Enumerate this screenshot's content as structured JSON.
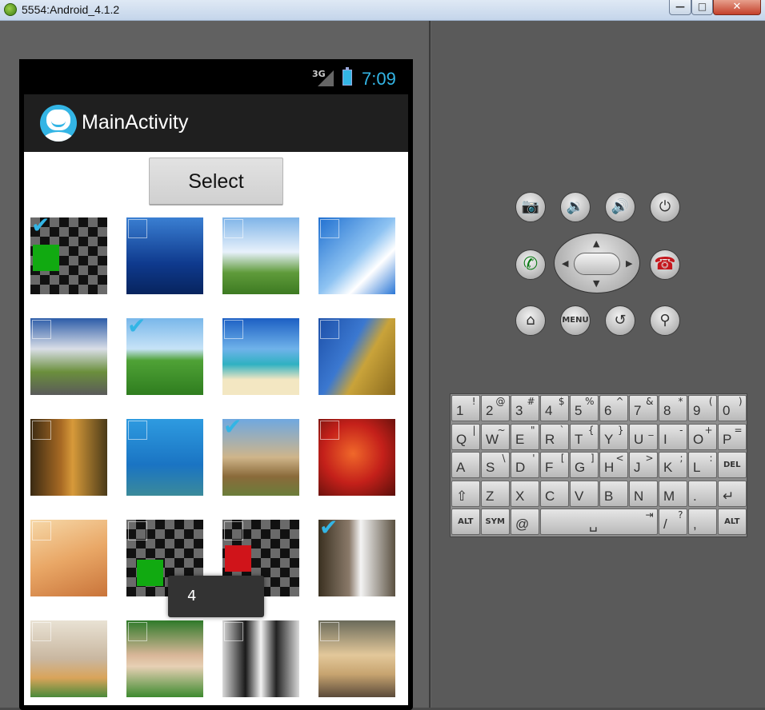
{
  "window": {
    "title": "5554:Android_4.1.2",
    "min_glyph": "—",
    "max_glyph": "□",
    "close_glyph": "✕"
  },
  "status_bar": {
    "network": "3G",
    "time": "7:09"
  },
  "action_bar": {
    "title": "MainActivity"
  },
  "main": {
    "select_label": "Select"
  },
  "toast": {
    "text": "4"
  },
  "colors": {
    "accent": "#33b5e5",
    "action_bar": "#1f1f1f",
    "checkbox_check": "#33b5e5"
  },
  "grid": {
    "columns": 4,
    "cells": [
      {
        "image": "checkerboard-green-square",
        "checked": true
      },
      {
        "image": "underwater-sharks",
        "checked": false
      },
      {
        "image": "sky-clouds-tree",
        "checked": false
      },
      {
        "image": "blue-sky-clouds",
        "checked": false
      },
      {
        "image": "cloudy-road-landscape",
        "checked": false
      },
      {
        "image": "green-field-sky",
        "checked": true
      },
      {
        "image": "tropical-beach",
        "checked": false
      },
      {
        "image": "giraffe-sky",
        "checked": false
      },
      {
        "image": "autumn-forest",
        "checked": false
      },
      {
        "image": "sea-turtle",
        "checked": false
      },
      {
        "image": "castle",
        "checked": true
      },
      {
        "image": "red-autumn-tree",
        "checked": false
      },
      {
        "image": "desert-dune",
        "checked": false
      },
      {
        "image": "checkerboard-green-square",
        "checked": false
      },
      {
        "image": "checkerboard-red-square",
        "checked": false
      },
      {
        "image": "monkey-dove",
        "checked": true
      },
      {
        "image": "hamster-eating",
        "checked": false
      },
      {
        "image": "hamster-grass",
        "checked": false
      },
      {
        "image": "penguins",
        "checked": false
      },
      {
        "image": "dog-litter",
        "checked": false
      }
    ]
  },
  "emulator_controls": {
    "top_row": [
      {
        "name": "camera-icon",
        "glyph": "📷"
      },
      {
        "name": "volume-down-icon",
        "glyph": "🔉"
      },
      {
        "name": "volume-up-icon",
        "glyph": "🔊"
      },
      {
        "name": "power-icon",
        "glyph": "⏻"
      }
    ],
    "call_glyph": "✆",
    "end_call_glyph": "☎",
    "bottom_row": [
      {
        "name": "home-icon",
        "glyph": "⌂"
      },
      {
        "name": "menu-button",
        "glyph": "MENU"
      },
      {
        "name": "back-icon",
        "glyph": "↺"
      },
      {
        "name": "search-icon",
        "glyph": "⚲"
      }
    ],
    "dpad_arrows": {
      "up": "▲",
      "down": "▼",
      "left": "◀",
      "right": "▶"
    }
  },
  "keyboard": {
    "rows": [
      [
        {
          "k": "1",
          "a": "!"
        },
        {
          "k": "2",
          "a": "@"
        },
        {
          "k": "3",
          "a": "#"
        },
        {
          "k": "4",
          "a": "$"
        },
        {
          "k": "5",
          "a": "%"
        },
        {
          "k": "6",
          "a": "^"
        },
        {
          "k": "7",
          "a": "&"
        },
        {
          "k": "8",
          "a": "*"
        },
        {
          "k": "9",
          "a": "("
        },
        {
          "k": "0",
          "a": ")"
        }
      ],
      [
        {
          "k": "Q",
          "a": "|"
        },
        {
          "k": "W",
          "a": "~"
        },
        {
          "k": "E",
          "a": "\""
        },
        {
          "k": "R",
          "a": "`"
        },
        {
          "k": "T",
          "a": "{"
        },
        {
          "k": "Y",
          "a": "}"
        },
        {
          "k": "U",
          "a": "_"
        },
        {
          "k": "I",
          "a": "-"
        },
        {
          "k": "O",
          "a": "+"
        },
        {
          "k": "P",
          "a": "="
        }
      ],
      [
        {
          "k": "A",
          "a": ""
        },
        {
          "k": "S",
          "a": "\\"
        },
        {
          "k": "D",
          "a": "'"
        },
        {
          "k": "F",
          "a": "["
        },
        {
          "k": "G",
          "a": "]"
        },
        {
          "k": "H",
          "a": "<"
        },
        {
          "k": "J",
          "a": ">"
        },
        {
          "k": "K",
          "a": ";"
        },
        {
          "k": "L",
          "a": ":"
        },
        {
          "k": "DEL",
          "a": ""
        }
      ],
      [
        {
          "k": "⇧",
          "a": ""
        },
        {
          "k": "Z",
          "a": ""
        },
        {
          "k": "X",
          "a": ""
        },
        {
          "k": "C",
          "a": ""
        },
        {
          "k": "V",
          "a": ""
        },
        {
          "k": "B",
          "a": ""
        },
        {
          "k": "N",
          "a": ""
        },
        {
          "k": "M",
          "a": ""
        },
        {
          "k": ".",
          "a": ""
        },
        {
          "k": "↵",
          "a": ""
        }
      ],
      [
        {
          "k": "ALT",
          "a": ""
        },
        {
          "k": "SYM",
          "a": ""
        },
        {
          "k": "@",
          "a": ""
        },
        {
          "k": "␣",
          "a": "⇥"
        },
        {
          "k": "/",
          "a": "?"
        },
        {
          "k": ",",
          "a": ""
        },
        {
          "k": "ALT",
          "a": ""
        }
      ]
    ]
  }
}
